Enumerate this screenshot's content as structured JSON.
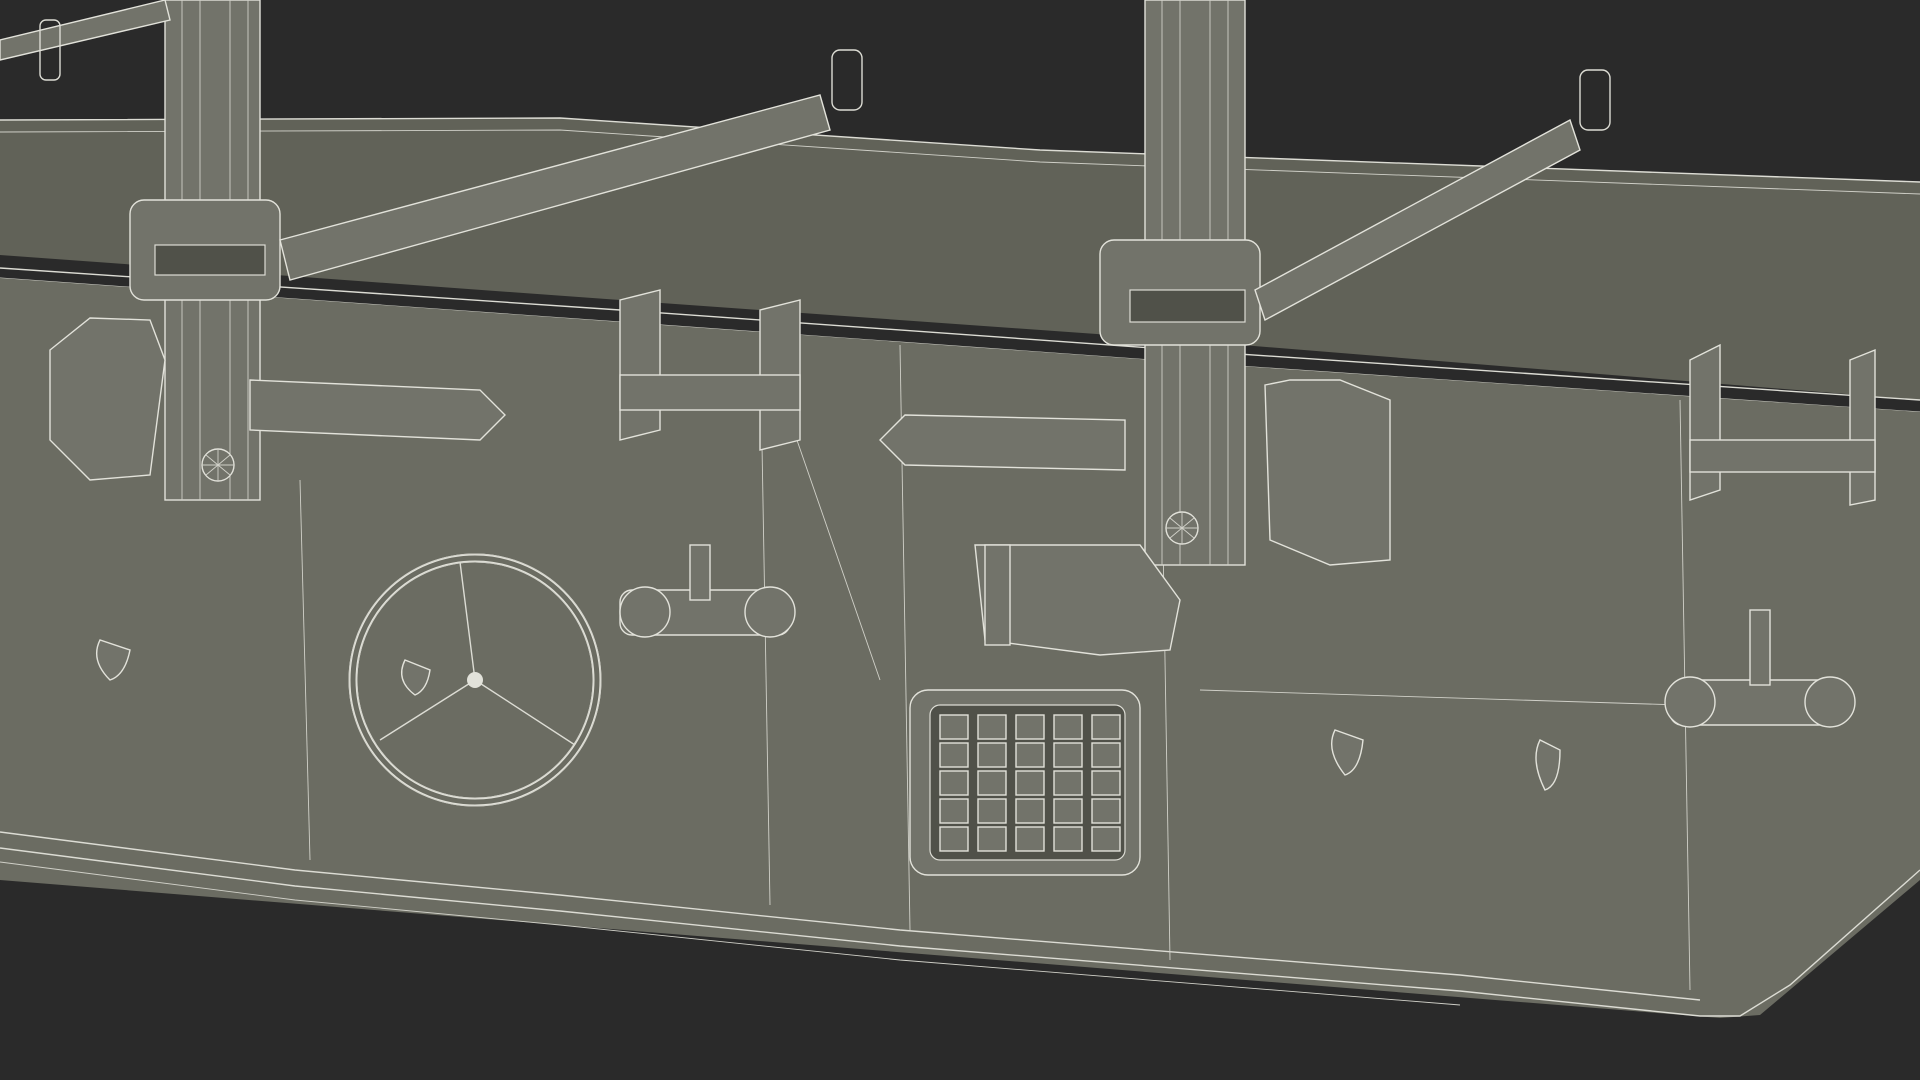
{
  "scene": {
    "colors": {
      "background": "#2a2a2a",
      "body": "#6b6c62",
      "top": "#616258",
      "wireframe": "#dcdcd4"
    }
  }
}
